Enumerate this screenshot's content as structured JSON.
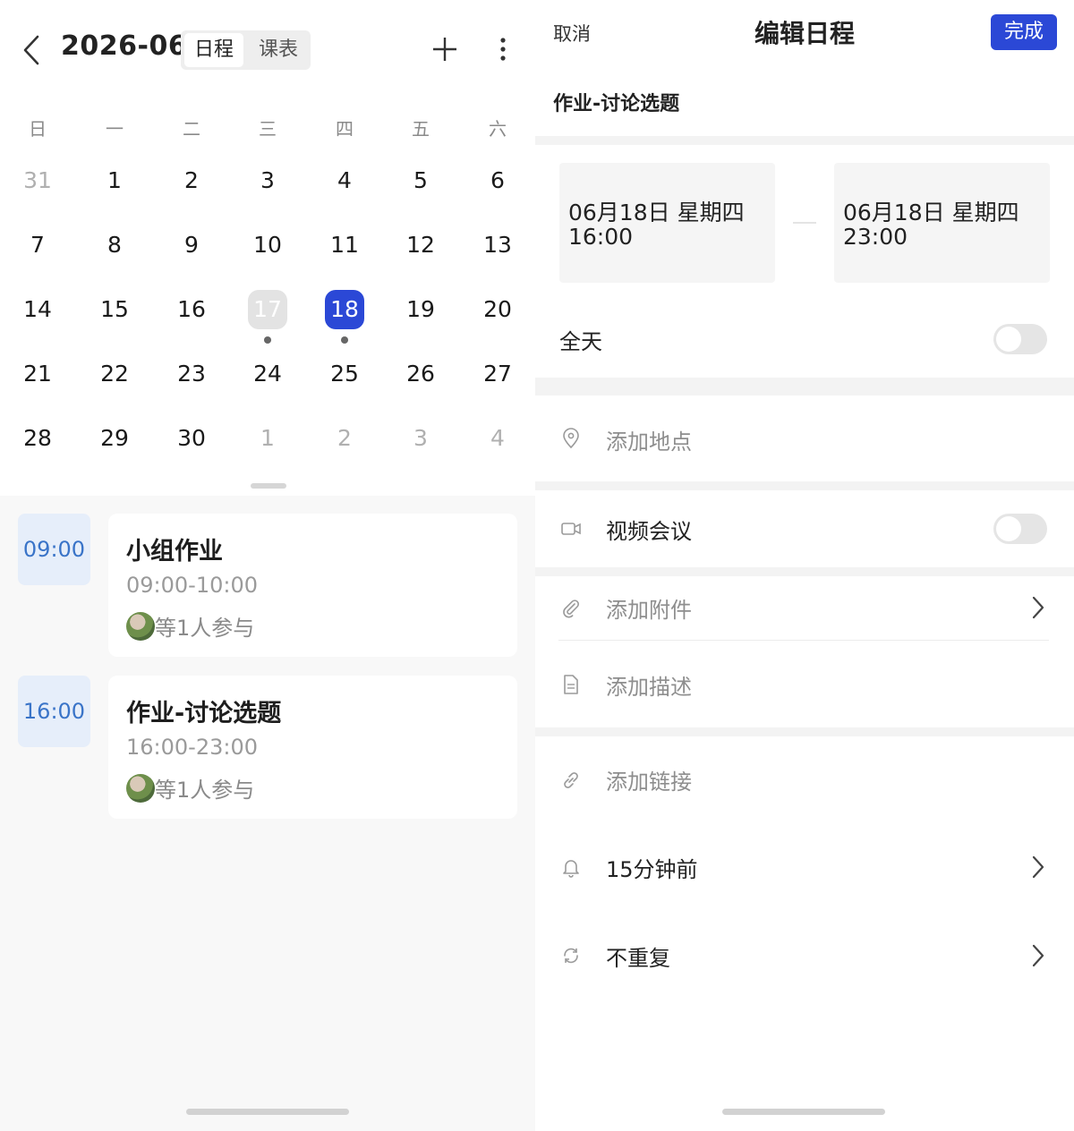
{
  "calendar_screen": {
    "month_title": "2026-06",
    "view_tabs": [
      "日程",
      "课表"
    ],
    "weekdays": [
      "日",
      "一",
      "二",
      "三",
      "四",
      "五",
      "六"
    ],
    "weeks": [
      [
        "31",
        "1",
        "2",
        "3",
        "4",
        "5",
        "6"
      ],
      [
        "7",
        "8",
        "9",
        "10",
        "11",
        "12",
        "13"
      ],
      [
        "14",
        "15",
        "16",
        "17",
        "18",
        "19",
        "20"
      ],
      [
        "21",
        "22",
        "23",
        "24",
        "25",
        "26",
        "27"
      ],
      [
        "28",
        "29",
        "30",
        "1",
        "2",
        "3",
        "4"
      ]
    ],
    "today_day": "17",
    "selected_day": "18",
    "days_with_events": [
      "17",
      "18"
    ],
    "events": [
      {
        "start": "09:00",
        "title": "小组作业",
        "time_range": "09:00-10:00",
        "participants": "等1人参与"
      },
      {
        "start": "16:00",
        "title": "作业-讨论选题",
        "time_range": "16:00-23:00",
        "participants": "等1人参与"
      }
    ],
    "colors": {
      "accent": "#2b48d6",
      "time_badge_bg": "#e6eefa",
      "time_badge_text": "#3a74c8"
    }
  },
  "edit_screen": {
    "cancel_label": "取消",
    "title": "编辑日程",
    "done_label": "完成",
    "event_name": "作业-讨论选题",
    "start": {
      "date": "06月18日 星期四",
      "time": "16:00"
    },
    "end": {
      "date": "06月18日 星期四",
      "time": "23:00"
    },
    "all_day_label": "全天",
    "all_day_on": false,
    "location_placeholder": "添加地点",
    "video_meeting_label": "视频会议",
    "video_meeting_on": false,
    "attachment_label": "添加附件",
    "description_placeholder": "添加描述",
    "link_placeholder": "添加链接",
    "reminder_label": "15分钟前",
    "repeat_label": "不重复",
    "icons": [
      "location-icon",
      "video-icon",
      "paperclip-icon",
      "document-icon",
      "link-icon",
      "bell-icon",
      "repeat-icon",
      "chevron-right-icon"
    ]
  }
}
